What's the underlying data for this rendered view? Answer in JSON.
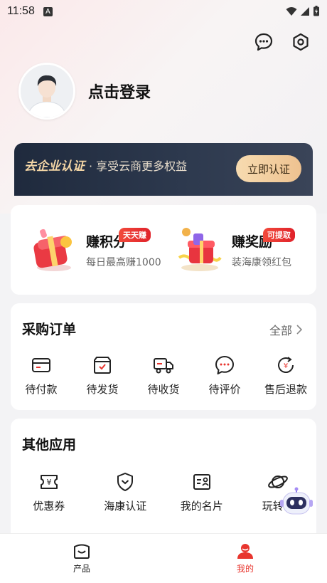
{
  "status_bar": {
    "time": "11:58",
    "a_badge": "A"
  },
  "profile": {
    "login_label": "点击登录"
  },
  "cert_banner": {
    "title": "去企业认证",
    "subtitle": "· 享受云商更多权益",
    "button": "立即认证"
  },
  "rewards": [
    {
      "title": "赚积分",
      "desc": "每日最高赚1000",
      "tag": "天天赚"
    },
    {
      "title": "赚奖励",
      "desc": "装海康领红包",
      "tag": "可提取"
    }
  ],
  "orders": {
    "title": "采购订单",
    "all_label": "全部",
    "items": [
      {
        "label": "待付款",
        "icon": "card-icon"
      },
      {
        "label": "待发货",
        "icon": "box-icon"
      },
      {
        "label": "待收货",
        "icon": "truck-icon"
      },
      {
        "label": "待评价",
        "icon": "chat-icon"
      },
      {
        "label": "售后退款",
        "icon": "refund-icon"
      }
    ]
  },
  "apps": {
    "title": "其他应用",
    "items": [
      {
        "label": "优惠券",
        "icon": "coupon-icon"
      },
      {
        "label": "海康认证",
        "icon": "shield-icon"
      },
      {
        "label": "我的名片",
        "icon": "namecard-icon"
      },
      {
        "label": "玩转云",
        "icon": "planet-icon"
      }
    ]
  },
  "tabbar": [
    {
      "label": "产品",
      "active": false
    },
    {
      "label": "我的",
      "active": true
    }
  ],
  "colors": {
    "accent": "#e8352e",
    "banner_dark": "#1f2a3d",
    "gold": "#f4d6a6"
  }
}
